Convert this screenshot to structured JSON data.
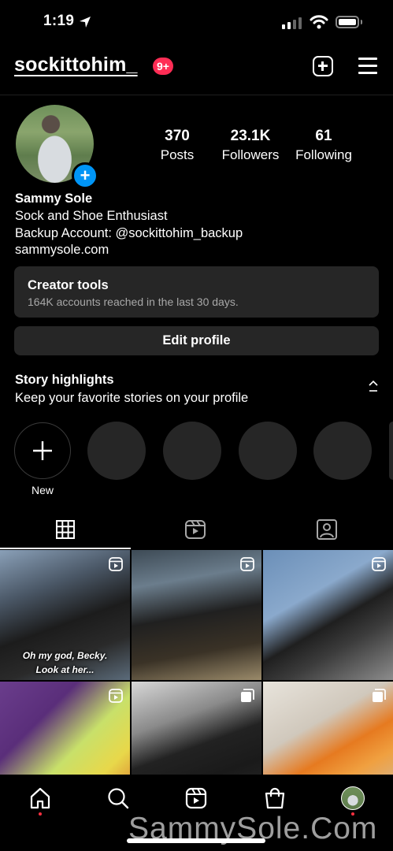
{
  "status_bar": {
    "time": "1:19"
  },
  "header": {
    "username": "sockittohim_",
    "notification_badge": "9+"
  },
  "profile": {
    "stats": [
      {
        "value": "370",
        "label": "Posts"
      },
      {
        "value": "23.1K",
        "label": "Followers"
      },
      {
        "value": "61",
        "label": "Following"
      }
    ],
    "name": "Sammy Sole",
    "bio_line1": "Sock and Shoe Enthusiast",
    "bio_line2": "Backup Account: @sockittohim_backup",
    "website": "sammysole.com"
  },
  "creator_tools": {
    "title": "Creator tools",
    "subtitle": "164K accounts reached in the last 30 days."
  },
  "edit_profile_label": "Edit profile",
  "highlights": {
    "title": "Story highlights",
    "subtitle": "Keep your favorite stories on your profile",
    "new_label": "New"
  },
  "tabs": {
    "icons": [
      "grid-icon",
      "reels-icon",
      "tagged-icon"
    ],
    "active": "grid-icon"
  },
  "posts": [
    {
      "type": "reel",
      "caption": "Oh my god, Becky.\nLook at her..."
    },
    {
      "type": "reel",
      "caption": ""
    },
    {
      "type": "reel",
      "caption": ""
    },
    {
      "type": "reel",
      "caption": ""
    },
    {
      "type": "carousel",
      "caption": ""
    },
    {
      "type": "carousel",
      "caption": ""
    }
  ],
  "bottom_nav": {
    "icons": [
      "home-icon",
      "search-icon",
      "reels-icon",
      "shop-icon",
      "profile-avatar"
    ]
  },
  "watermark": "SammySole.Com",
  "colors": {
    "accent_blue": "#0095f6",
    "badge_red": "#ff2d55",
    "card_bg": "#262626"
  }
}
